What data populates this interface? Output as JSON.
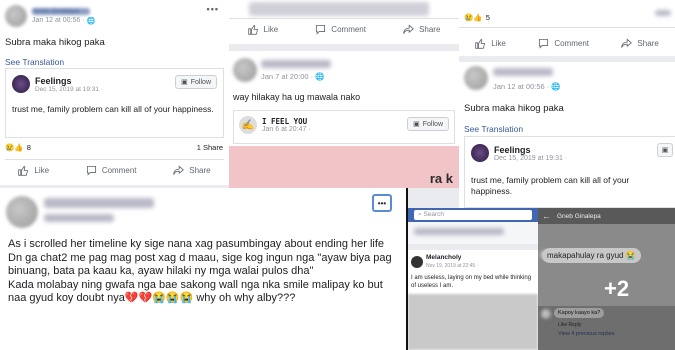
{
  "p1": {
    "author": "Gneb Ginalepa",
    "time": "Jan 12 at 00:56 ·",
    "text": "Subra maka hikog paka",
    "see_translation": "See Translation",
    "shared": {
      "name": "Feelings",
      "time": "Dec 15, 2019 at 19:31 ·",
      "follow": "Follow",
      "text": "trust me, family problem can kill all of your happiness."
    },
    "reactions_count": "8",
    "shares": "1 Share",
    "actions": {
      "like": "Like",
      "comment": "Comment",
      "share": "Share"
    }
  },
  "p2": {
    "time": "Jan 7 at 20:00 ·",
    "text": "way hilakay ha ug mawala nako",
    "shared": {
      "name": "I FEEL YOU",
      "time": "Jan 6 at 20:47 ·",
      "follow": "Follow"
    },
    "actions": {
      "like": "Like",
      "comment": "Comment",
      "share": "Share"
    },
    "pink_text": "ra k"
  },
  "p3": {
    "reactions_count": "5",
    "actions": {
      "like": "Like",
      "comment": "Comment",
      "share": "Share"
    },
    "time": "Jan 12 at 00:56 ·",
    "text": "Subra maka hikog paka",
    "see_translation": "See Translation",
    "shared": {
      "name": "Feelings",
      "time": "Dec 15, 2019 at 19:31 ·",
      "text": "trust me, family problem can kill all of your happiness."
    }
  },
  "p4": {
    "lines": [
      "As i scrolled her timeline ky sige nana xag pasumbingay about ending her life",
      "Dn ga chat2 me pag mag post xag d maau, sige kog ingun nga \"ayaw biya pag binuang, bata pa kaau ka, ayaw hilaki ny mga walai pulos dha\"",
      "Kada molabay ning gwafa nga bae sakong wall nga nka smile malipay ko but naa gyud koy doubt nya💔💔😭😭😭 why oh why alby???"
    ],
    "more": "•••"
  },
  "p5": {
    "search": "Search",
    "name": "Melancholy",
    "time": "Nov 19, 2019 at 22:45 ·",
    "text": "I am useless, laying on my bed while thinking of useless I am."
  },
  "p6": {
    "title": "Gneb Ginalepa",
    "message": "makapahulay ra gyud 😭",
    "overlay": "+2",
    "reply": "Kapoy kaayo ka?",
    "reply_actions": "Like  Reply",
    "view_replies": "View 4 previous replies"
  }
}
